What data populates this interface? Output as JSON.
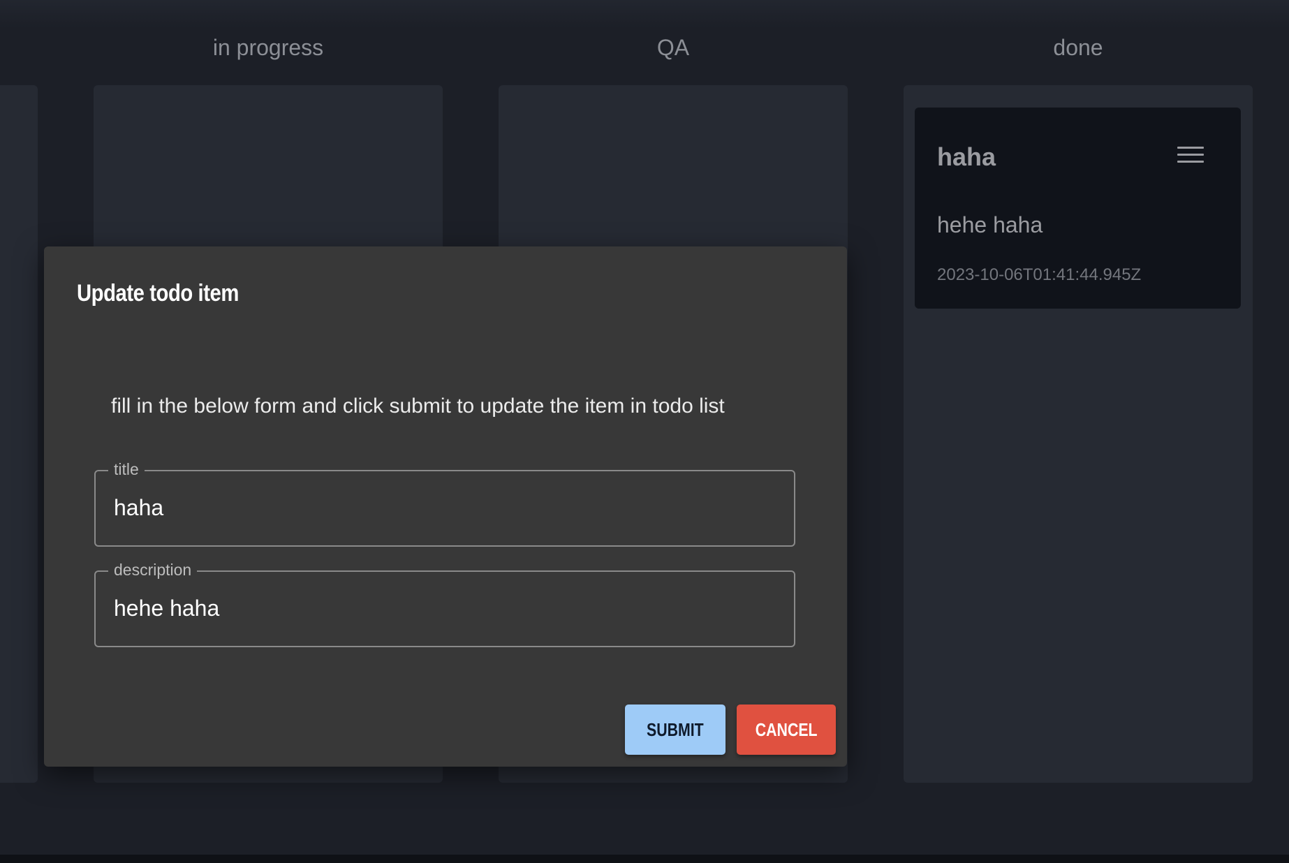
{
  "columns": [
    {
      "title": ""
    },
    {
      "title": "in progress"
    },
    {
      "title": "QA"
    },
    {
      "title": "done"
    }
  ],
  "card": {
    "title": "haha",
    "description": "hehe haha",
    "timestamp": "2023-10-06T01:41:44.945Z",
    "menu_icon": "hamburger-menu-icon"
  },
  "dialog": {
    "title": "Update todo item",
    "text": "fill in the below form and click submit to update the item in todo list",
    "fields": {
      "title": {
        "label": "title",
        "value": "haha"
      },
      "description": {
        "label": "description",
        "value": "hehe haha"
      }
    },
    "submit_label": "SUBMIT",
    "cancel_label": "CANCEL"
  },
  "colors": {
    "background": "#1c1f27",
    "column": "#262a33",
    "card": "#10131a",
    "dialog": "#383838",
    "submit": "#9ecbf7",
    "cancel": "#e05140"
  }
}
